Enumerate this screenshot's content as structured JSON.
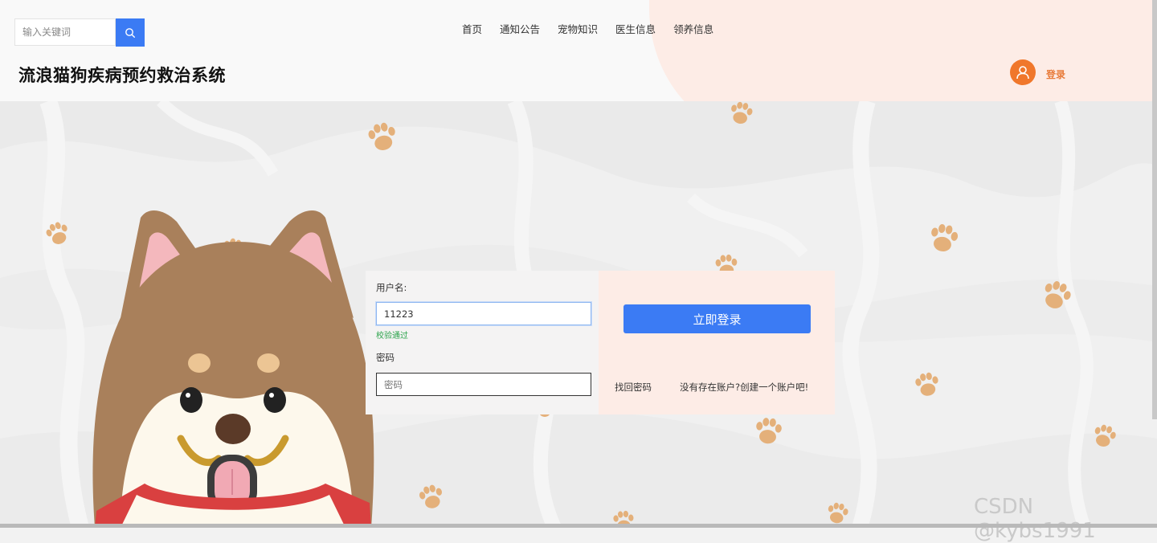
{
  "header": {
    "search_placeholder": "输入关键词",
    "nav": [
      "首页",
      "通知公告",
      "宠物知识",
      "医生信息",
      "领养信息"
    ],
    "site_title": "流浪猫狗疾病预约救治系统",
    "login_label": "登录"
  },
  "login_form": {
    "username_label": "用户名:",
    "username_value": "11223",
    "username_status": "校验通过",
    "password_label": "密码",
    "password_placeholder": "密码",
    "submit_label": "立即登录",
    "forgot_link": "找回密码",
    "register_link": "没有存在账户?创建一个账户吧!"
  },
  "watermark": "CSDN @kybs1991",
  "colors": {
    "accent_blue": "#3b7bf4",
    "accent_orange": "#f0772b",
    "panel_pink": "#fdece6",
    "valid_green": "#2aa34a",
    "paw": "#e4b07a",
    "dog_brown": "#a9805b"
  },
  "icons": {
    "search": "search-icon",
    "user_avatar": "user-icon"
  }
}
